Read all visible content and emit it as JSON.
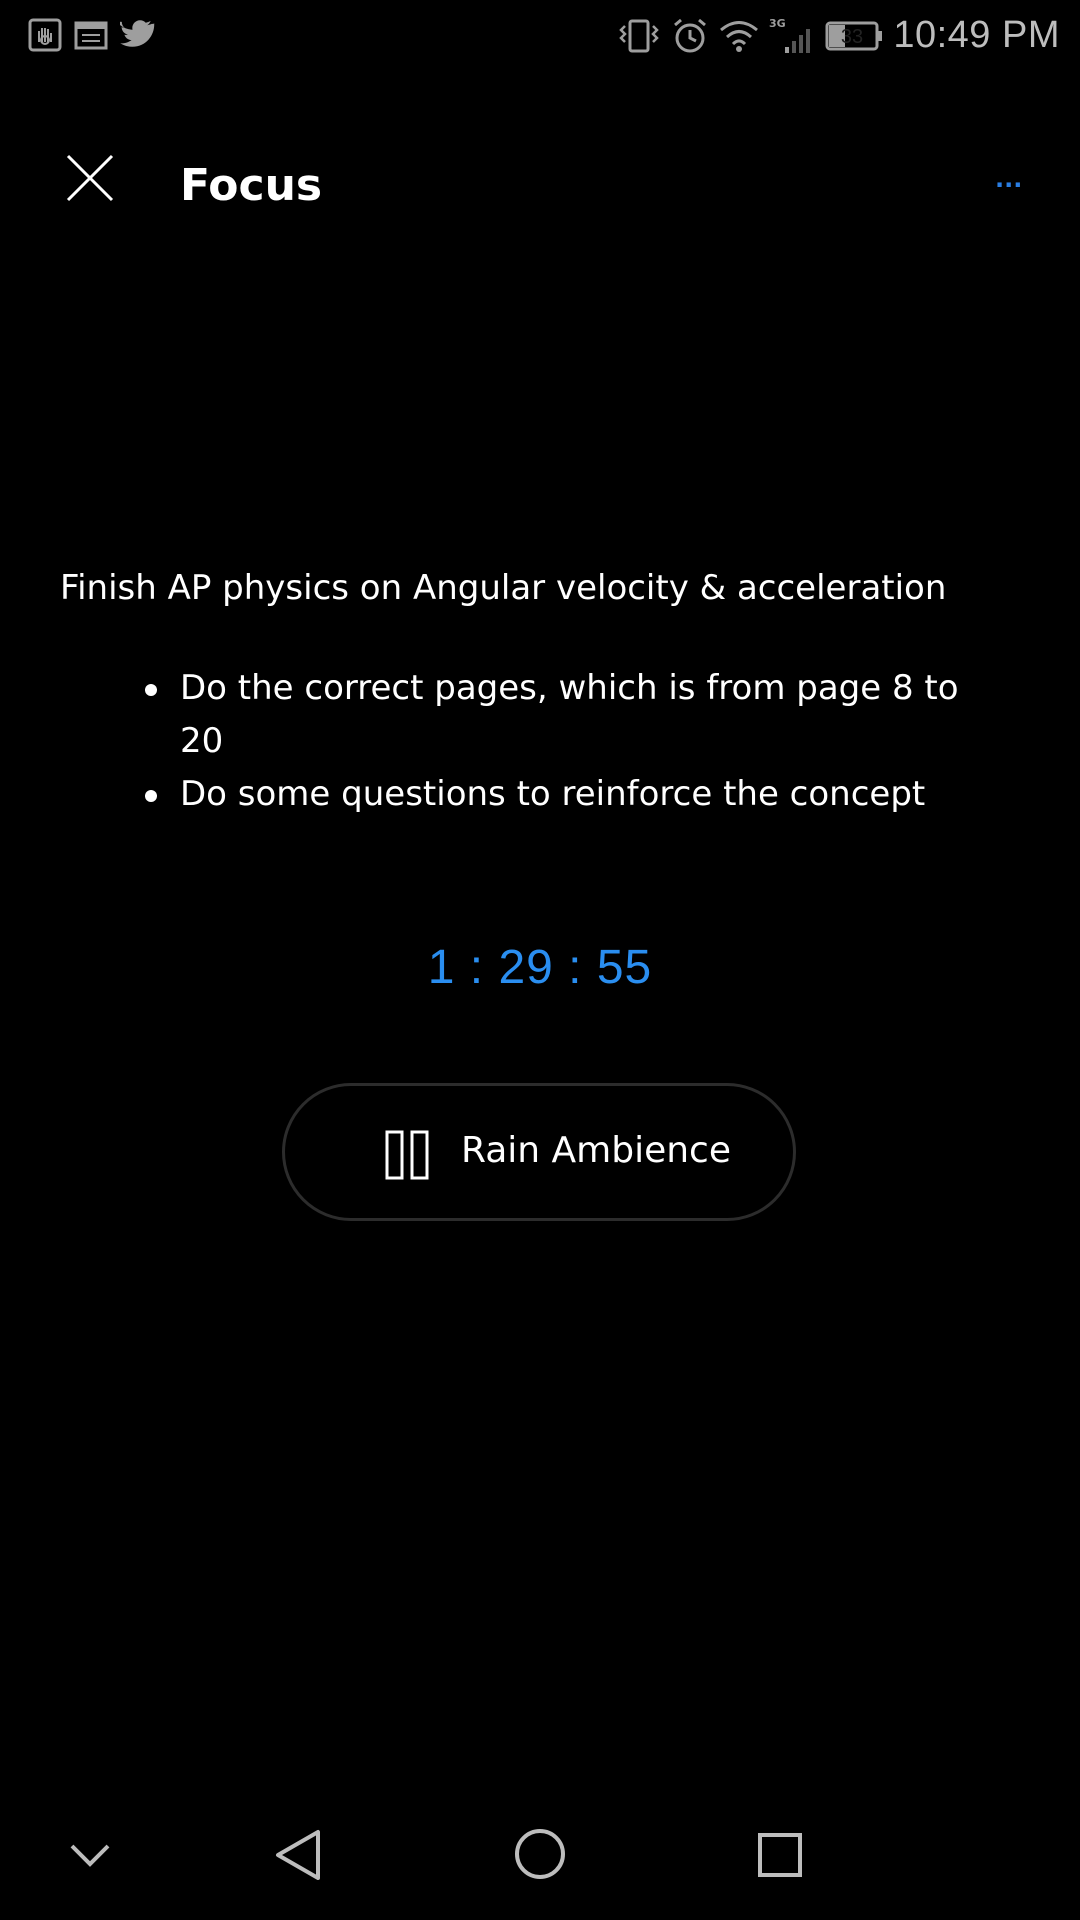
{
  "status_bar": {
    "time": "10:49 PM",
    "battery": "33",
    "network": "3G",
    "left_icons": [
      "hand-app-icon",
      "calendar-icon",
      "twitter-icon"
    ],
    "right_icons": [
      "vibrate-icon",
      "alarm-icon",
      "wifi-icon",
      "signal-icon",
      "battery-icon"
    ]
  },
  "header": {
    "title": "Focus",
    "more_label": "···",
    "close_icon": "close-icon"
  },
  "task": {
    "title": "Finish AP physics on Angular velocity & acceleration",
    "items": [
      "Do the correct pages, which is from page 8 to 20",
      "Do some questions to reinforce the concept"
    ]
  },
  "timer": {
    "value": "1 : 29 : 55"
  },
  "ambience": {
    "label": "Rain Ambience",
    "icon": "pause-icon"
  },
  "nav_bar": {
    "icons": [
      "chevron-down-icon",
      "back-icon",
      "home-icon",
      "recents-icon"
    ]
  },
  "colors": {
    "background": "#000000",
    "accent": "#2a8ef0",
    "text": "#ffffff",
    "status_text": "#bdbdbd"
  }
}
